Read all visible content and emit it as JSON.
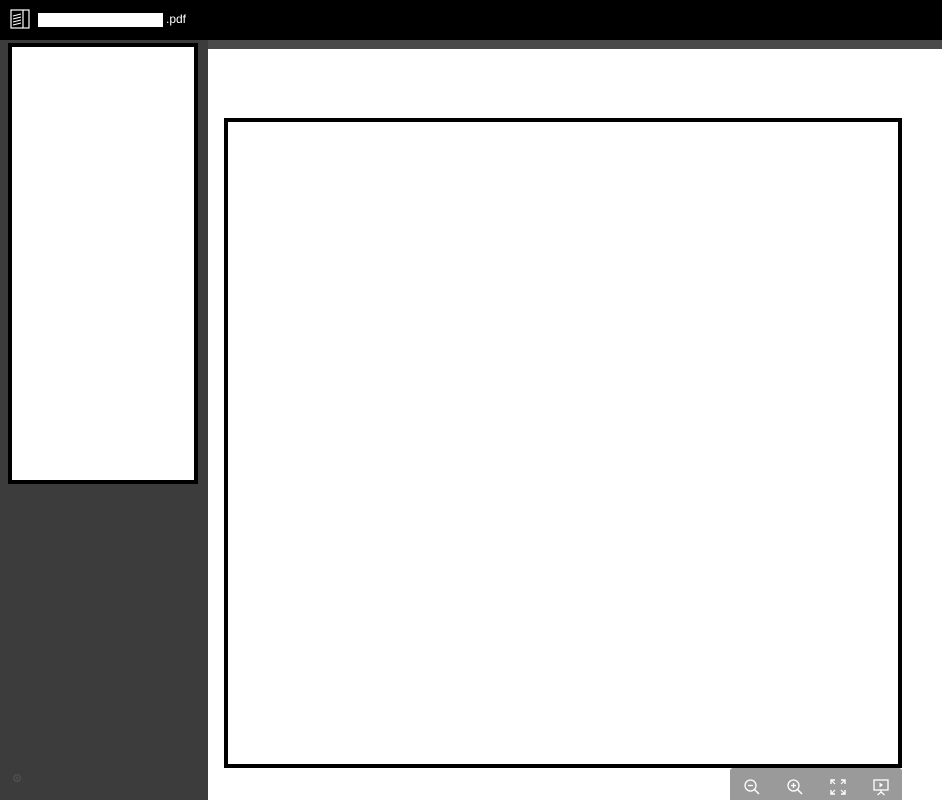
{
  "header": {
    "filename_extension": ".pdf",
    "app_icon": "document-list-icon"
  },
  "sidebar": {
    "settings_icon": "gear-icon"
  },
  "toolbar": {
    "buttons": [
      {
        "icon": "zoom-out-icon"
      },
      {
        "icon": "zoom-in-icon"
      },
      {
        "icon": "fullscreen-icon"
      },
      {
        "icon": "presentation-icon"
      }
    ]
  },
  "colors": {
    "topbar": "#000000",
    "sidebar": "#3c3c3c",
    "viewer": "#ffffff",
    "toolbar": "#9a9a9a"
  }
}
